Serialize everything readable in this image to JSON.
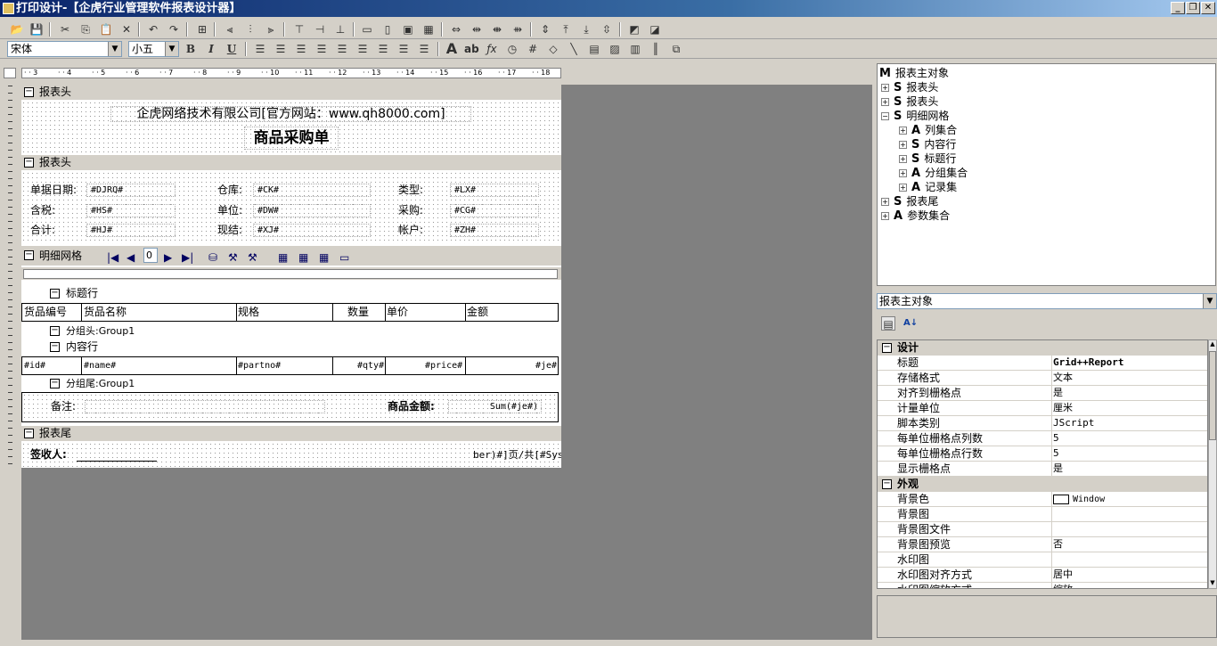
{
  "window": {
    "title": "打印设计-【企虎行业管理软件报表设计器】"
  },
  "font_toolbar": {
    "font_name": "宋体",
    "font_size": "小五",
    "bold": "B",
    "italic": "I",
    "underline": "U"
  },
  "report": {
    "header_band1": {
      "label": "报表头",
      "company": "企虎网络技术有限公司[官方网站：www.qh8000.com]",
      "title": "商品采购单"
    },
    "header_band2": {
      "label": "报表头",
      "fields": [
        {
          "label": "单据日期:",
          "value": "#DJRQ#"
        },
        {
          "label": "仓库:",
          "value": "#CK#"
        },
        {
          "label": "类型:",
          "value": "#LX#"
        },
        {
          "label": "含税:",
          "value": "#HS#"
        },
        {
          "label": "单位:",
          "value": "#DW#"
        },
        {
          "label": "采购:",
          "value": "#CG#"
        },
        {
          "label": "合计:",
          "value": "#HJ#"
        },
        {
          "label": "现结:",
          "value": "#XJ#"
        },
        {
          "label": "帐户:",
          "value": "#ZH#"
        }
      ]
    },
    "detail_grid": {
      "label": "明细网格",
      "page_input": "0",
      "title_row_label": "标题行",
      "columns": [
        "货品编号",
        "货品名称",
        "规格",
        "数量",
        "单价",
        "金额"
      ],
      "group_header": "分组头:Group1",
      "content_row_label": "内容行",
      "content_cells": [
        "#id#",
        "#name#",
        "#partno#",
        "#qty#",
        "#price#",
        "#je#"
      ],
      "group_footer": "分组尾:Group1",
      "remark_label": "备注:",
      "amount_label": "商品金额:",
      "amount_value": "Sum(#je#)"
    },
    "footer_band": {
      "label": "报表尾",
      "signer_label": "签收人:",
      "page_text": "ber)#]页/共[#Sys"
    }
  },
  "object_tree": {
    "root": "报表主对象",
    "nodes": [
      {
        "glyph": "S",
        "label": "报表头",
        "level": 1
      },
      {
        "glyph": "S",
        "label": "报表头",
        "level": 1
      },
      {
        "glyph": "S",
        "label": "明细网格",
        "level": 1,
        "expanded": true
      },
      {
        "glyph": "A",
        "label": "列集合",
        "level": 2
      },
      {
        "glyph": "S",
        "label": "内容行",
        "level": 2
      },
      {
        "glyph": "S",
        "label": "标题行",
        "level": 2
      },
      {
        "glyph": "A",
        "label": "分组集合",
        "level": 2
      },
      {
        "glyph": "A",
        "label": "记录集",
        "level": 2
      },
      {
        "glyph": "S",
        "label": "报表尾",
        "level": 1
      },
      {
        "glyph": "A",
        "label": "参数集合",
        "level": 1
      }
    ]
  },
  "object_select": {
    "value": "报表主对象"
  },
  "properties": [
    {
      "category": "设计"
    },
    {
      "key": "标题",
      "value": "Grid++Report"
    },
    {
      "key": "存储格式",
      "value": "文本"
    },
    {
      "key": "对齐到栅格点",
      "value": "是"
    },
    {
      "key": "计量单位",
      "value": "厘米"
    },
    {
      "key": "脚本类别",
      "value": "JScript"
    },
    {
      "key": "每单位栅格点列数",
      "value": "5"
    },
    {
      "key": "每单位栅格点行数",
      "value": "5"
    },
    {
      "key": "显示栅格点",
      "value": "是"
    },
    {
      "category": "外观"
    },
    {
      "key": "背景色",
      "value": "Window"
    },
    {
      "key": "背景图",
      "value": ""
    },
    {
      "key": "背景图文件",
      "value": ""
    },
    {
      "key": "背景图预览",
      "value": "否"
    },
    {
      "key": "水印图",
      "value": ""
    },
    {
      "key": "水印图对齐方式",
      "value": "居中"
    },
    {
      "key": "水印图缩放方式",
      "value": "缩放"
    }
  ]
}
